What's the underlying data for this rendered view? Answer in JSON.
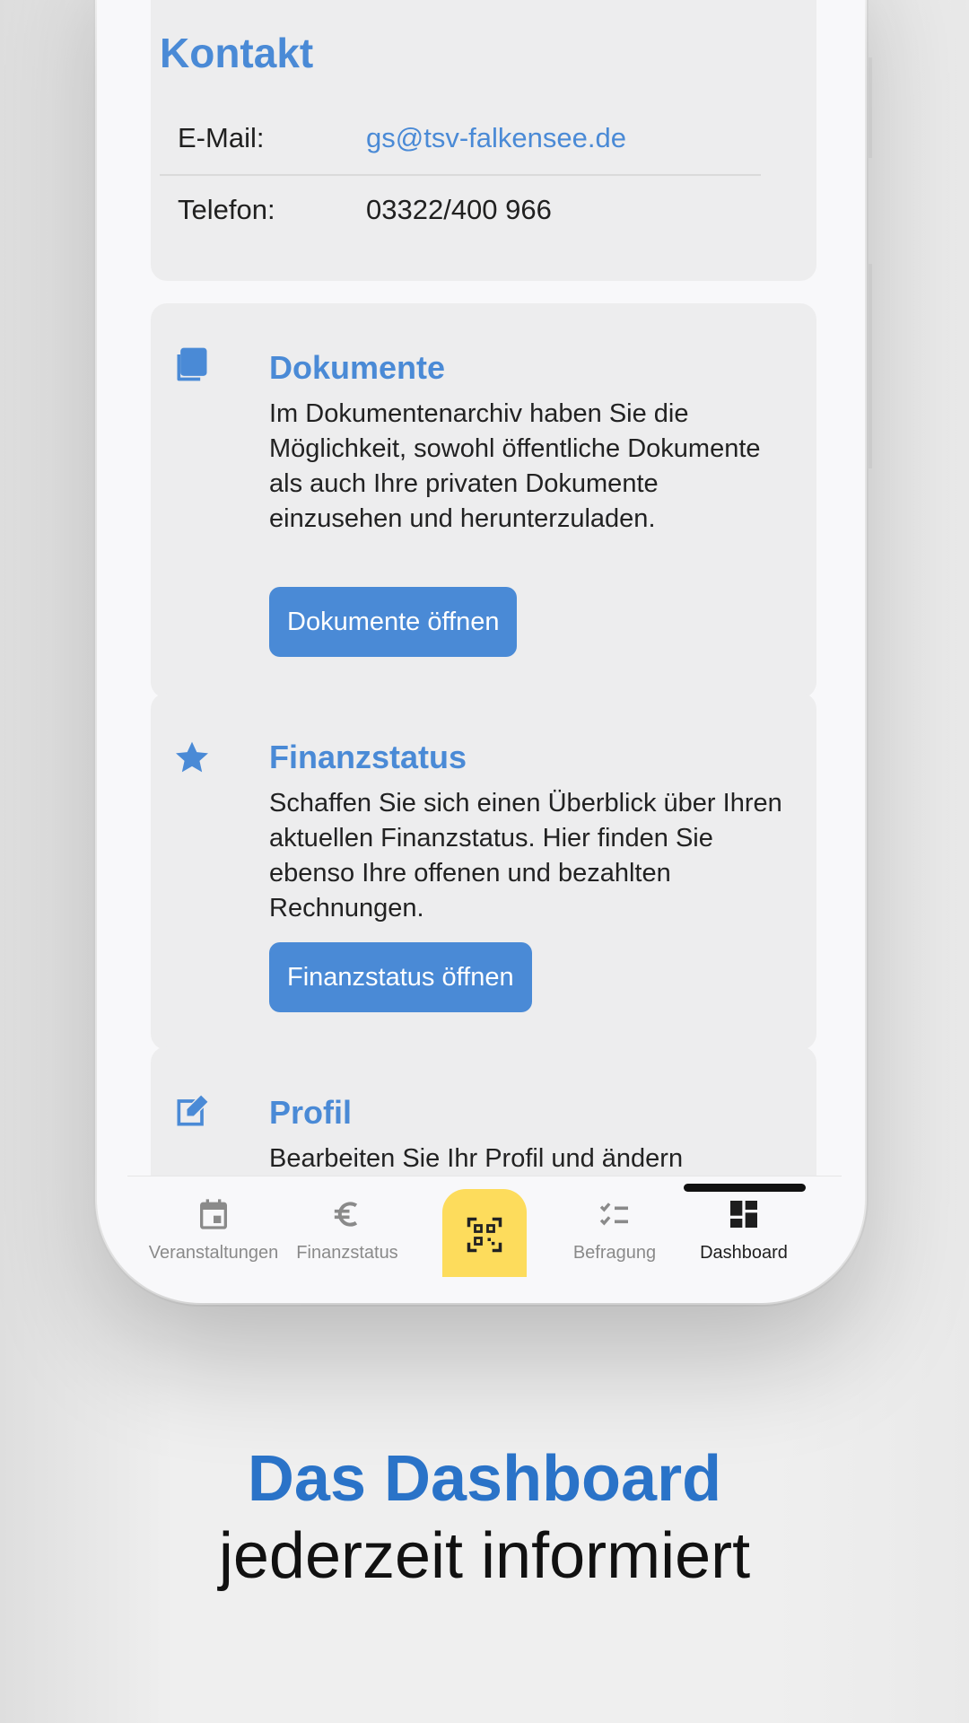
{
  "kontakt": {
    "title": "Kontakt",
    "email_label": "E-Mail:",
    "email_value": "gs@tsv-falkensee.de",
    "phone_label": "Telefon:",
    "phone_value": "03322/400 966"
  },
  "cards": [
    {
      "icon": "documents-icon",
      "title": "Dokumente",
      "text": "Im Dokumentenarchiv haben Sie die Möglichkeit, sowohl öffentliche Dokumente als auch Ihre privaten Dokumente einzusehen und herunterzuladen.",
      "button": "Dokumente öffnen"
    },
    {
      "icon": "star-icon",
      "title": "Finanzstatus",
      "text": "Schaffen Sie sich einen Überblick über Ihren aktuellen Finanzstatus. Hier finden Sie ebenso Ihre offenen und bezahlten Rechnungen.",
      "button": "Finanzstatus öffnen"
    },
    {
      "icon": "edit-icon",
      "title": "Profil",
      "text": "Bearbeiten Sie Ihr Profil und ändern"
    }
  ],
  "nav": {
    "items": [
      {
        "label": "Veranstaltungen",
        "icon": "calendar-icon"
      },
      {
        "label": "Finanzstatus",
        "icon": "euro-icon"
      },
      {
        "label": "",
        "icon": "qr-code-icon"
      },
      {
        "label": "Befragung",
        "icon": "checklist-icon"
      },
      {
        "label": "Dashboard",
        "icon": "dashboard-icon",
        "active": true
      }
    ]
  },
  "promo": {
    "title": "Das Dashboard",
    "subtitle": "jederzeit informiert"
  },
  "colors": {
    "accent": "#4a8ad6",
    "promo_title": "#2a73c8",
    "qr_button": "#fddc5c",
    "card_bg": "#ededee"
  }
}
